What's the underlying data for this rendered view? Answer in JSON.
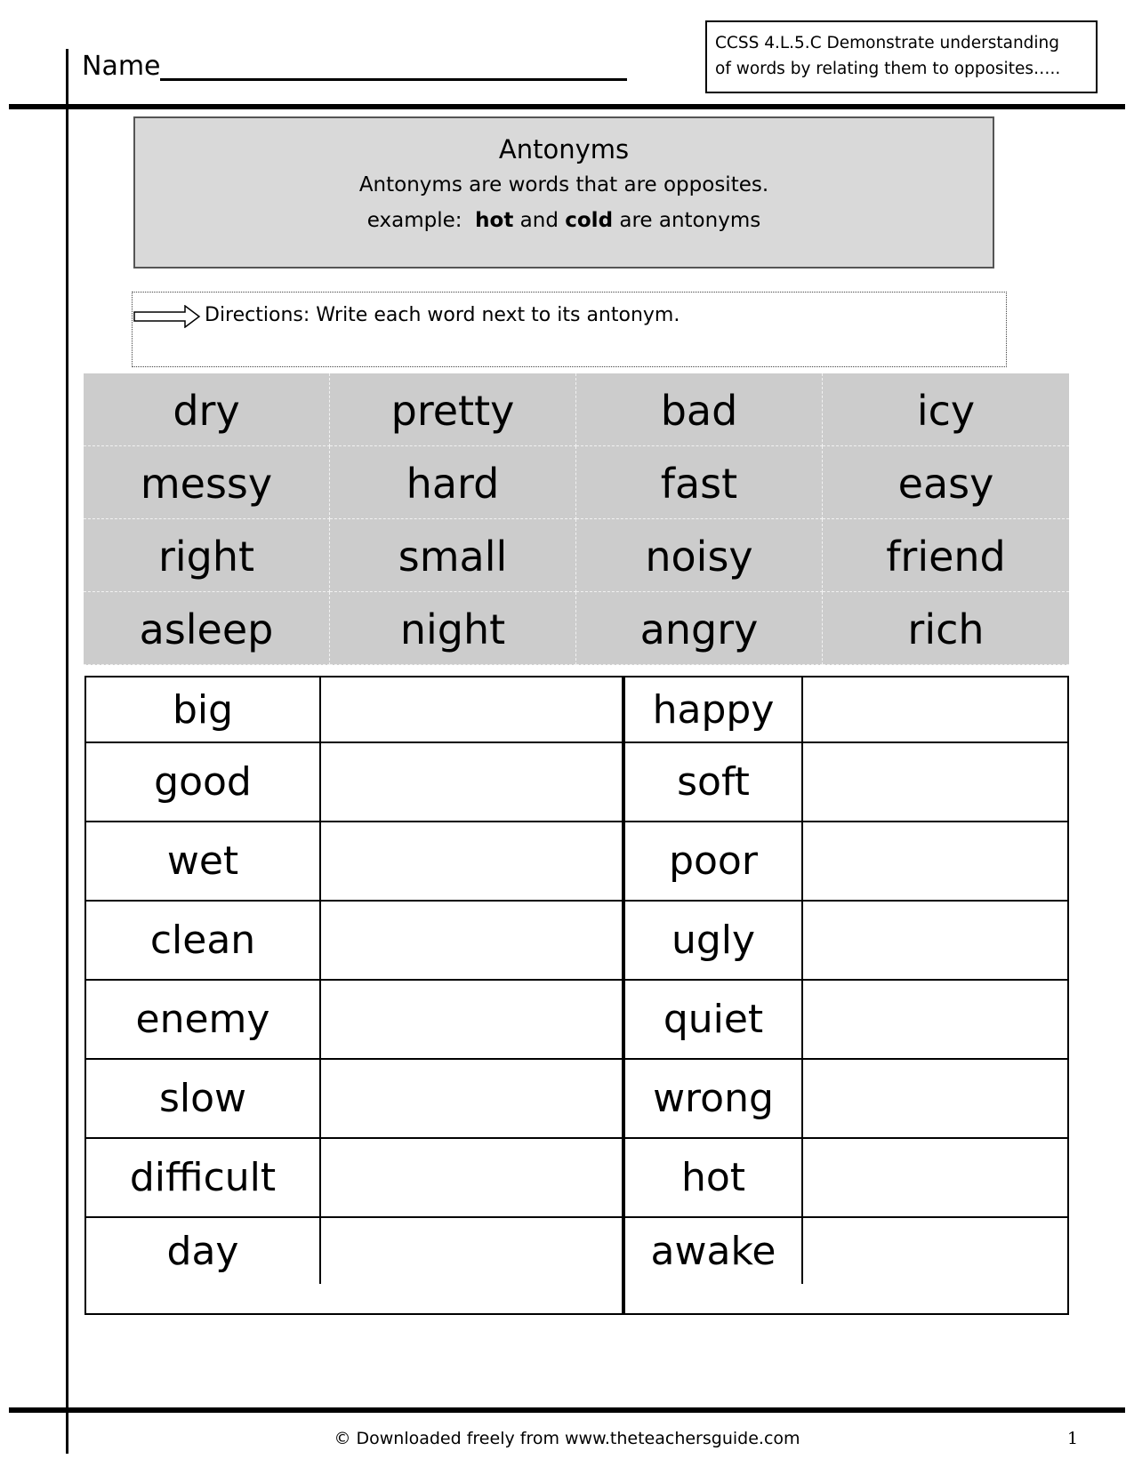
{
  "header": {
    "name_label": "Name",
    "standard_line1": "CCSS 4.L.5.C Demonstrate understanding",
    "standard_line2": "of words by relating them to opposites….."
  },
  "info": {
    "title": "Antonyms",
    "definition": "Antonyms are words that are opposites.",
    "example_prefix": "example:",
    "example_word1": "hot",
    "example_and": "and",
    "example_word2": "cold",
    "example_suffix": "are antonyms"
  },
  "directions": {
    "icon": "arrow-right-icon",
    "text": "Directions: Write each word next to its antonym."
  },
  "word_bank": [
    [
      "dry",
      "pretty",
      "bad",
      "icy"
    ],
    [
      "messy",
      "hard",
      "fast",
      "easy"
    ],
    [
      "right",
      "small",
      "noisy",
      "friend"
    ],
    [
      "asleep",
      "night",
      "angry",
      "rich"
    ]
  ],
  "answer_table": {
    "left": [
      "big",
      "good",
      "wet",
      "clean",
      "enemy",
      "slow",
      "difficult",
      "day"
    ],
    "right": [
      "happy",
      "soft",
      "poor",
      "ugly",
      "quiet",
      "wrong",
      "hot",
      "awake"
    ]
  },
  "footer": {
    "text": "© Downloaded freely from www.theteachersguide.com",
    "page_number": "1"
  }
}
